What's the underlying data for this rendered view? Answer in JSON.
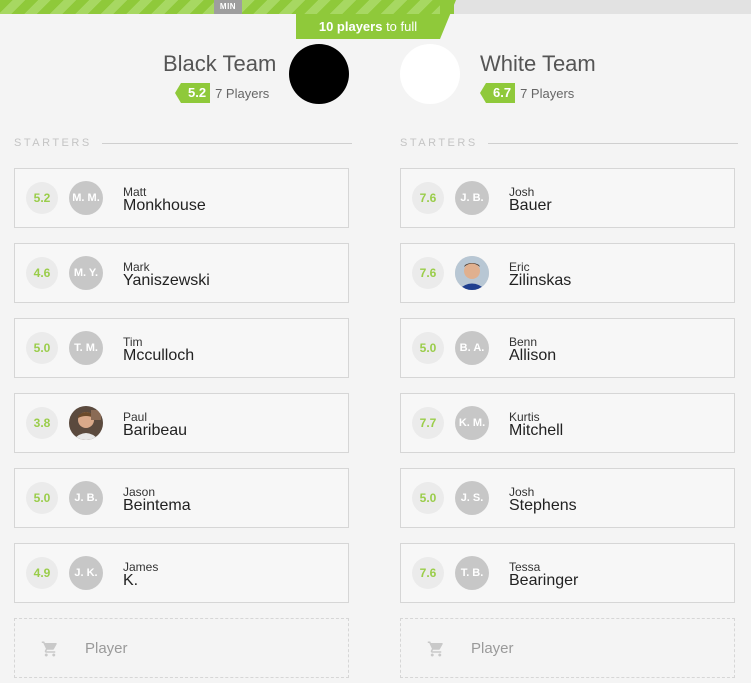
{
  "progress": {
    "min_label": "MIN",
    "filled_fraction": 0.605,
    "players_needed": "10 players",
    "to_full_suffix": " to full"
  },
  "colors": {
    "accent": "#8fc93a",
    "black_team": "#000000",
    "white_team": "#ffffff"
  },
  "teams": {
    "black": {
      "name": "Black Team",
      "rating": "5.2",
      "count": "7 Players",
      "section": "STARTERS",
      "add_label": "Player",
      "players": [
        {
          "rating": "5.2",
          "initials": "M. M.",
          "first": "Matt",
          "last": "Monkhouse",
          "photo": false
        },
        {
          "rating": "4.6",
          "initials": "M. Y.",
          "first": "Mark",
          "last": "Yaniszewski",
          "photo": false
        },
        {
          "rating": "5.0",
          "initials": "T. M.",
          "first": "Tim",
          "last": "Mcculloch",
          "photo": false
        },
        {
          "rating": "3.8",
          "initials": "",
          "first": "Paul",
          "last": "Baribeau",
          "photo": true
        },
        {
          "rating": "5.0",
          "initials": "J. B.",
          "first": "Jason",
          "last": "Beintema",
          "photo": false
        },
        {
          "rating": "4.9",
          "initials": "J. K.",
          "first": "James",
          "last": "K.",
          "photo": false
        }
      ]
    },
    "white": {
      "name": "White Team",
      "rating": "6.7",
      "count": "7 Players",
      "section": "STARTERS",
      "add_label": "Player",
      "players": [
        {
          "rating": "7.6",
          "initials": "J. B.",
          "first": "Josh",
          "last": "Bauer",
          "photo": false
        },
        {
          "rating": "7.6",
          "initials": "",
          "first": "Eric",
          "last": "Zilinskas",
          "photo": true
        },
        {
          "rating": "5.0",
          "initials": "B. A.",
          "first": "Benn",
          "last": "Allison",
          "photo": false
        },
        {
          "rating": "7.7",
          "initials": "K. M.",
          "first": "Kurtis",
          "last": "Mitchell",
          "photo": false
        },
        {
          "rating": "5.0",
          "initials": "J. S.",
          "first": "Josh",
          "last": "Stephens",
          "photo": false
        },
        {
          "rating": "7.6",
          "initials": "T. B.",
          "first": "Tessa",
          "last": "Bearinger",
          "photo": false
        }
      ]
    }
  }
}
